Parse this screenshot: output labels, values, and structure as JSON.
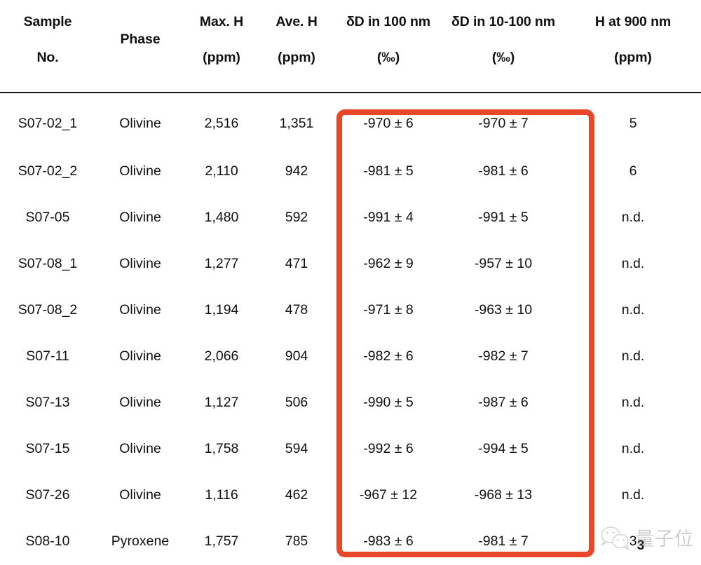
{
  "document": {
    "page_number": "3",
    "watermark": {
      "text": "量子位",
      "logo": "wechat-icon"
    }
  },
  "annotation": {
    "type": "rounded-rectangle-highlight",
    "color": "#E8472A",
    "covers_columns": [
      "δD in 100 nm (‰)",
      "δD in 10-100 nm (‰)"
    ]
  },
  "table": {
    "headers": [
      {
        "line1": "Sample",
        "line2": "No.",
        "stacked": true
      },
      {
        "line1": "Phase",
        "line2": "",
        "stacked": false
      },
      {
        "line1": "Max. H",
        "line2": "(ppm)",
        "stacked": true
      },
      {
        "line1": "Ave. H",
        "line2": "(ppm)",
        "stacked": true
      },
      {
        "line1": "δD in 100 nm",
        "line2": "(‰)",
        "stacked": true
      },
      {
        "line1": "δD in 10-100 nm",
        "line2": "(‰)",
        "stacked": true
      },
      {
        "line1": "H at 900 nm",
        "line2": "(ppm)",
        "stacked": true
      }
    ],
    "rows": [
      {
        "sample": "S07-02_1",
        "phase": "Olivine",
        "max_h": "2,516",
        "ave_h": "1,351",
        "dd_100nm": "-970 ± 6",
        "dd_10_100nm": "-970 ± 7",
        "h_900nm": "5"
      },
      {
        "sample": "S07-02_2",
        "phase": "Olivine",
        "max_h": "2,110",
        "ave_h": "942",
        "dd_100nm": "-981 ± 5",
        "dd_10_100nm": "-981 ± 6",
        "h_900nm": "6"
      },
      {
        "sample": "S07-05",
        "phase": "Olivine",
        "max_h": "1,480",
        "ave_h": "592",
        "dd_100nm": "-991 ± 4",
        "dd_10_100nm": "-991 ± 5",
        "h_900nm": "n.d."
      },
      {
        "sample": "S07-08_1",
        "phase": "Olivine",
        "max_h": "1,277",
        "ave_h": "471",
        "dd_100nm": "-962 ± 9",
        "dd_10_100nm": "-957 ± 10",
        "h_900nm": "n.d."
      },
      {
        "sample": "S07-08_2",
        "phase": "Olivine",
        "max_h": "1,194",
        "ave_h": "478",
        "dd_100nm": "-971 ± 8",
        "dd_10_100nm": "-963 ± 10",
        "h_900nm": "n.d."
      },
      {
        "sample": "S07-11",
        "phase": "Olivine",
        "max_h": "2,066",
        "ave_h": "904",
        "dd_100nm": "-982 ± 6",
        "dd_10_100nm": "-982 ± 7",
        "h_900nm": "n.d."
      },
      {
        "sample": "S07-13",
        "phase": "Olivine",
        "max_h": "1,127",
        "ave_h": "506",
        "dd_100nm": "-990 ± 5",
        "dd_10_100nm": "-987 ± 6",
        "h_900nm": "n.d."
      },
      {
        "sample": "S07-15",
        "phase": "Olivine",
        "max_h": "1,758",
        "ave_h": "594",
        "dd_100nm": "-992 ± 6",
        "dd_10_100nm": "-994 ± 5",
        "h_900nm": "n.d."
      },
      {
        "sample": "S07-26",
        "phase": "Olivine",
        "max_h": "1,116",
        "ave_h": "462",
        "dd_100nm": "-967 ± 12",
        "dd_10_100nm": "-968 ± 13",
        "h_900nm": "n.d."
      },
      {
        "sample": "S08-10",
        "phase": "Pyroxene",
        "max_h": "1,757",
        "ave_h": "785",
        "dd_100nm": "-983 ± 6",
        "dd_10_100nm": "-981 ± 7",
        "h_900nm": "3"
      }
    ]
  }
}
